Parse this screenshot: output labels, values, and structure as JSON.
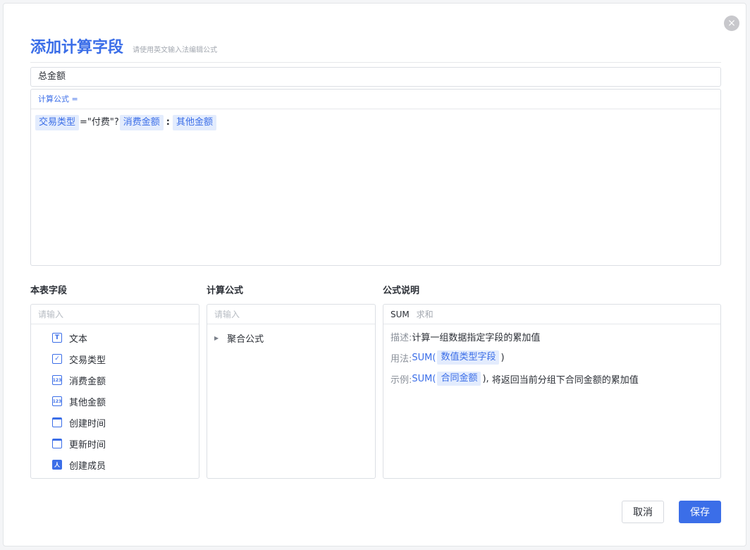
{
  "dialog": {
    "title": "添加计算字段",
    "subtitle": "请使用英文输入法编辑公式",
    "close_icon": "×"
  },
  "field_name": {
    "value": "总金额"
  },
  "formula": {
    "label": "计算公式 =",
    "tokens": [
      {
        "type": "field",
        "text": "交易类型"
      },
      {
        "type": "op",
        "text": "=\"付费\"?"
      },
      {
        "type": "field",
        "text": "消费金额"
      },
      {
        "type": "op",
        "text": ":"
      },
      {
        "type": "field",
        "text": "其他金额"
      }
    ]
  },
  "fields_panel": {
    "heading": "本表字段",
    "placeholder": "请输入",
    "items": [
      {
        "icon": "text-icon",
        "glyph": "T",
        "label": "文本"
      },
      {
        "icon": "checkbox-icon",
        "glyph": "✓",
        "label": "交易类型"
      },
      {
        "icon": "number-icon",
        "glyph": "123",
        "label": "消费金额"
      },
      {
        "icon": "number-icon",
        "glyph": "123",
        "label": "其他金额"
      },
      {
        "icon": "calendar-icon",
        "glyph": "",
        "label": "创建时间"
      },
      {
        "icon": "calendar-icon",
        "glyph": "",
        "label": "更新时间"
      },
      {
        "icon": "person-icon",
        "glyph": "人",
        "label": "创建成员"
      }
    ]
  },
  "functions_panel": {
    "heading": "计算公式",
    "placeholder": "请输入",
    "categories": [
      {
        "label": "聚合公式",
        "icon": "caret-right-icon"
      }
    ]
  },
  "description_panel": {
    "heading": "公式说明",
    "function_name": "SUM",
    "function_alias": "求和",
    "description_key": "描述:",
    "description_value": "计算一组数据指定字段的累加值",
    "usage_key": "用法:",
    "usage_fn": "SUM(",
    "usage_arg": "数值类型字段",
    "usage_close": ")",
    "example_key": "示例:",
    "example_fn": "SUM(",
    "example_arg": "合同金额",
    "example_close": "),",
    "example_text": "将返回当前分组下合同金额的累加值"
  },
  "buttons": {
    "cancel": "取消",
    "save": "保存"
  },
  "colors": {
    "accent": "#3b6ee8",
    "tag_bg": "#e3ecfd",
    "border": "#dcdfe4"
  }
}
